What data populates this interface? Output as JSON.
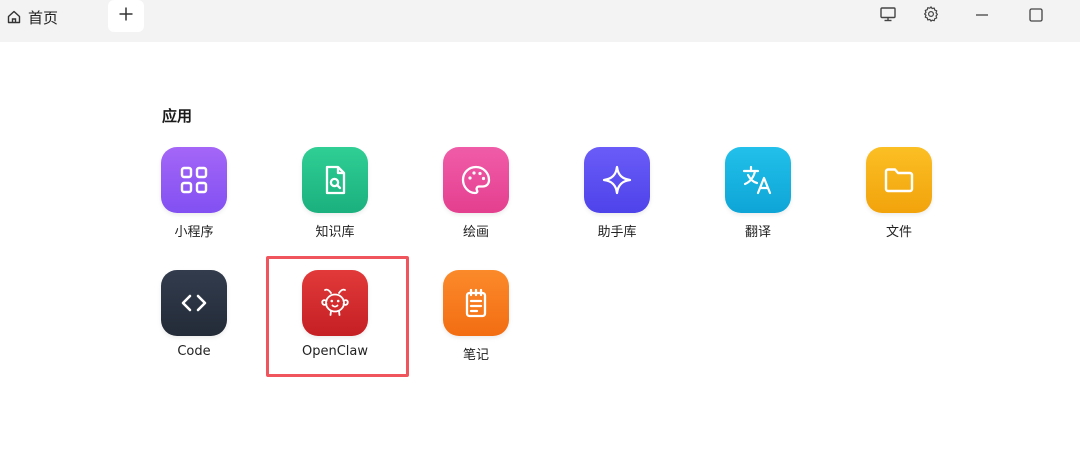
{
  "titlebar": {
    "home_tab_label": "首页",
    "icons": {
      "home": "home-icon",
      "new_tab": "plus-icon",
      "monitor": "monitor-icon",
      "settings": "gear-icon",
      "minimize": "minimize-icon",
      "maximize": "maximize-icon"
    }
  },
  "apps_section": {
    "title": "应用",
    "apps": [
      {
        "label": "小程序",
        "icon": "grid-icon",
        "color": "#8b5cf6"
      },
      {
        "label": "知识库",
        "icon": "document-search-icon",
        "color": "#22c08a"
      },
      {
        "label": "绘画",
        "icon": "palette-icon",
        "color": "#ec4899"
      },
      {
        "label": "助手库",
        "icon": "sparkle-icon",
        "color": "#5b4ff5"
      },
      {
        "label": "翻译",
        "icon": "translate-icon",
        "color": "#14b4e0"
      },
      {
        "label": "文件",
        "icon": "folder-icon",
        "color": "#f5b20f"
      },
      {
        "label": "Code",
        "icon": "code-icon",
        "color": "#2b3443"
      },
      {
        "label": "OpenClaw",
        "icon": "claw-creature-icon",
        "color": "#d62a2a"
      },
      {
        "label": "笔记",
        "icon": "notepad-icon",
        "color": "#f97316"
      }
    ],
    "highlight_color": "#f0555d"
  }
}
